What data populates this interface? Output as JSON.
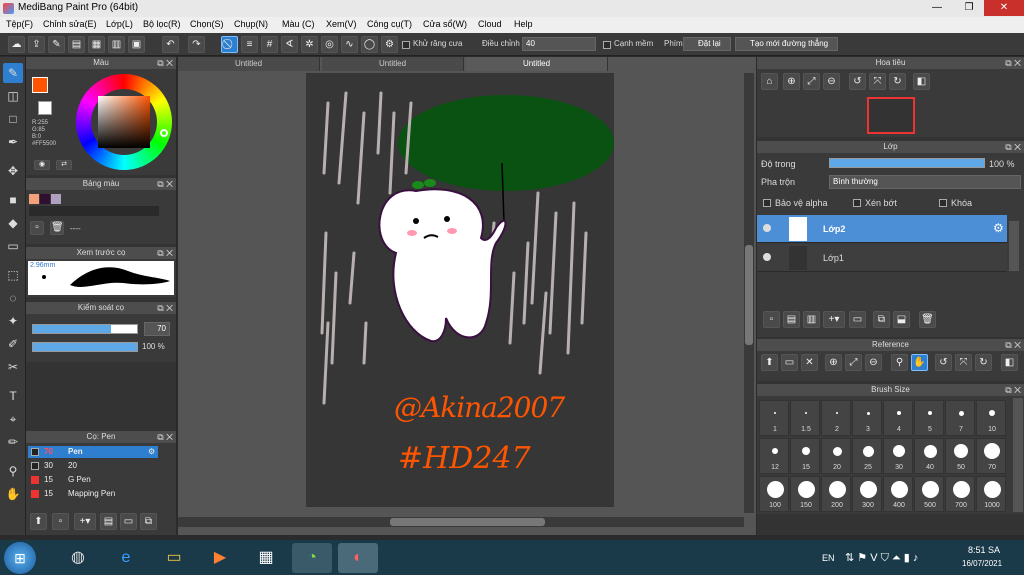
{
  "window": {
    "title": "MediBang Paint Pro (64bit)",
    "minimize": "—",
    "restore": "❐",
    "close": "✕"
  },
  "menu": [
    "Tệp(F)",
    "Chỉnh sửa(E)",
    "Lớp(L)",
    "Bộ lọc(R)",
    "Chọn(S)",
    "Chụp(N)",
    "Màu (C)",
    "Xem(V)",
    "Công cụ(T)",
    "Cửa sổ(W)",
    "Cloud",
    "Help"
  ],
  "toolbar": {
    "antialias_label": "Khử răng cưa",
    "correction_label": "Điều chỉnh",
    "correction_value": "40",
    "edge_label": "Cạnh mềm",
    "phim_label": "Phím",
    "reset_label": "Đặt lại",
    "ruler_label": "Tạo mới đường thẳng"
  },
  "color_panel": {
    "title": "Màu",
    "r": "R:255",
    "g": "G:85",
    "b": "B:0",
    "hex": "#FF5500",
    "primary": "#FF5500"
  },
  "palette_panel": {
    "title": "Bảng màu",
    "swatches": [
      "#f4a07a",
      "#301030",
      "#b0a0c0"
    ],
    "dash": "----"
  },
  "brush_preview": {
    "title": "Xem trước cọ",
    "size": "2.96mm"
  },
  "brush_control": {
    "title": "Kiểm soát cọ",
    "size_value": "70",
    "opacity_value": "100 %",
    "size_fraction": 0.75,
    "opacity_fraction": 1.0
  },
  "brush_list": {
    "title": "Cọ: Pen",
    "items": [
      {
        "size": "70",
        "name": "Pen",
        "color": "#e33"
      },
      {
        "size": "30",
        "name": "20",
        "color": "#222"
      },
      {
        "size": "15",
        "name": "G Pen",
        "color": "#e33"
      },
      {
        "size": "15",
        "name": "Mapping Pen",
        "color": "#e33"
      }
    ]
  },
  "tabs": [
    "Untitled",
    "Untitled",
    "Untitled"
  ],
  "artwork": {
    "signature": "@Akina2007",
    "hashtag": "#HD247",
    "text_color": "#FF5500"
  },
  "navigator": {
    "title": "Hoa tiêu"
  },
  "layers": {
    "title": "Lớp",
    "opacity_label": "Độ trong",
    "opacity_value": "100 %",
    "opacity_fraction": 1.0,
    "blend_label": "Pha trộn",
    "blend_value": "Bình thường",
    "alpha_protect": "Bảo vệ alpha",
    "clipping": "Xén bớt",
    "lock": "Khóa",
    "items": [
      {
        "name": "Lớp2",
        "selected": true
      },
      {
        "name": "Lớp1",
        "selected": false
      }
    ]
  },
  "reference": {
    "title": "Reference"
  },
  "brush_size": {
    "title": "Brush Size",
    "sizes": [
      "1",
      "1.5",
      "2",
      "3",
      "4",
      "5",
      "7",
      "10",
      "12",
      "15",
      "20",
      "25",
      "30",
      "40",
      "50",
      "70",
      "100",
      "150",
      "200",
      "300",
      "400",
      "500",
      "700",
      "1000"
    ]
  },
  "taskbar": {
    "lang": "EN",
    "time": "8:51 SA",
    "date": "16/07/2021"
  }
}
